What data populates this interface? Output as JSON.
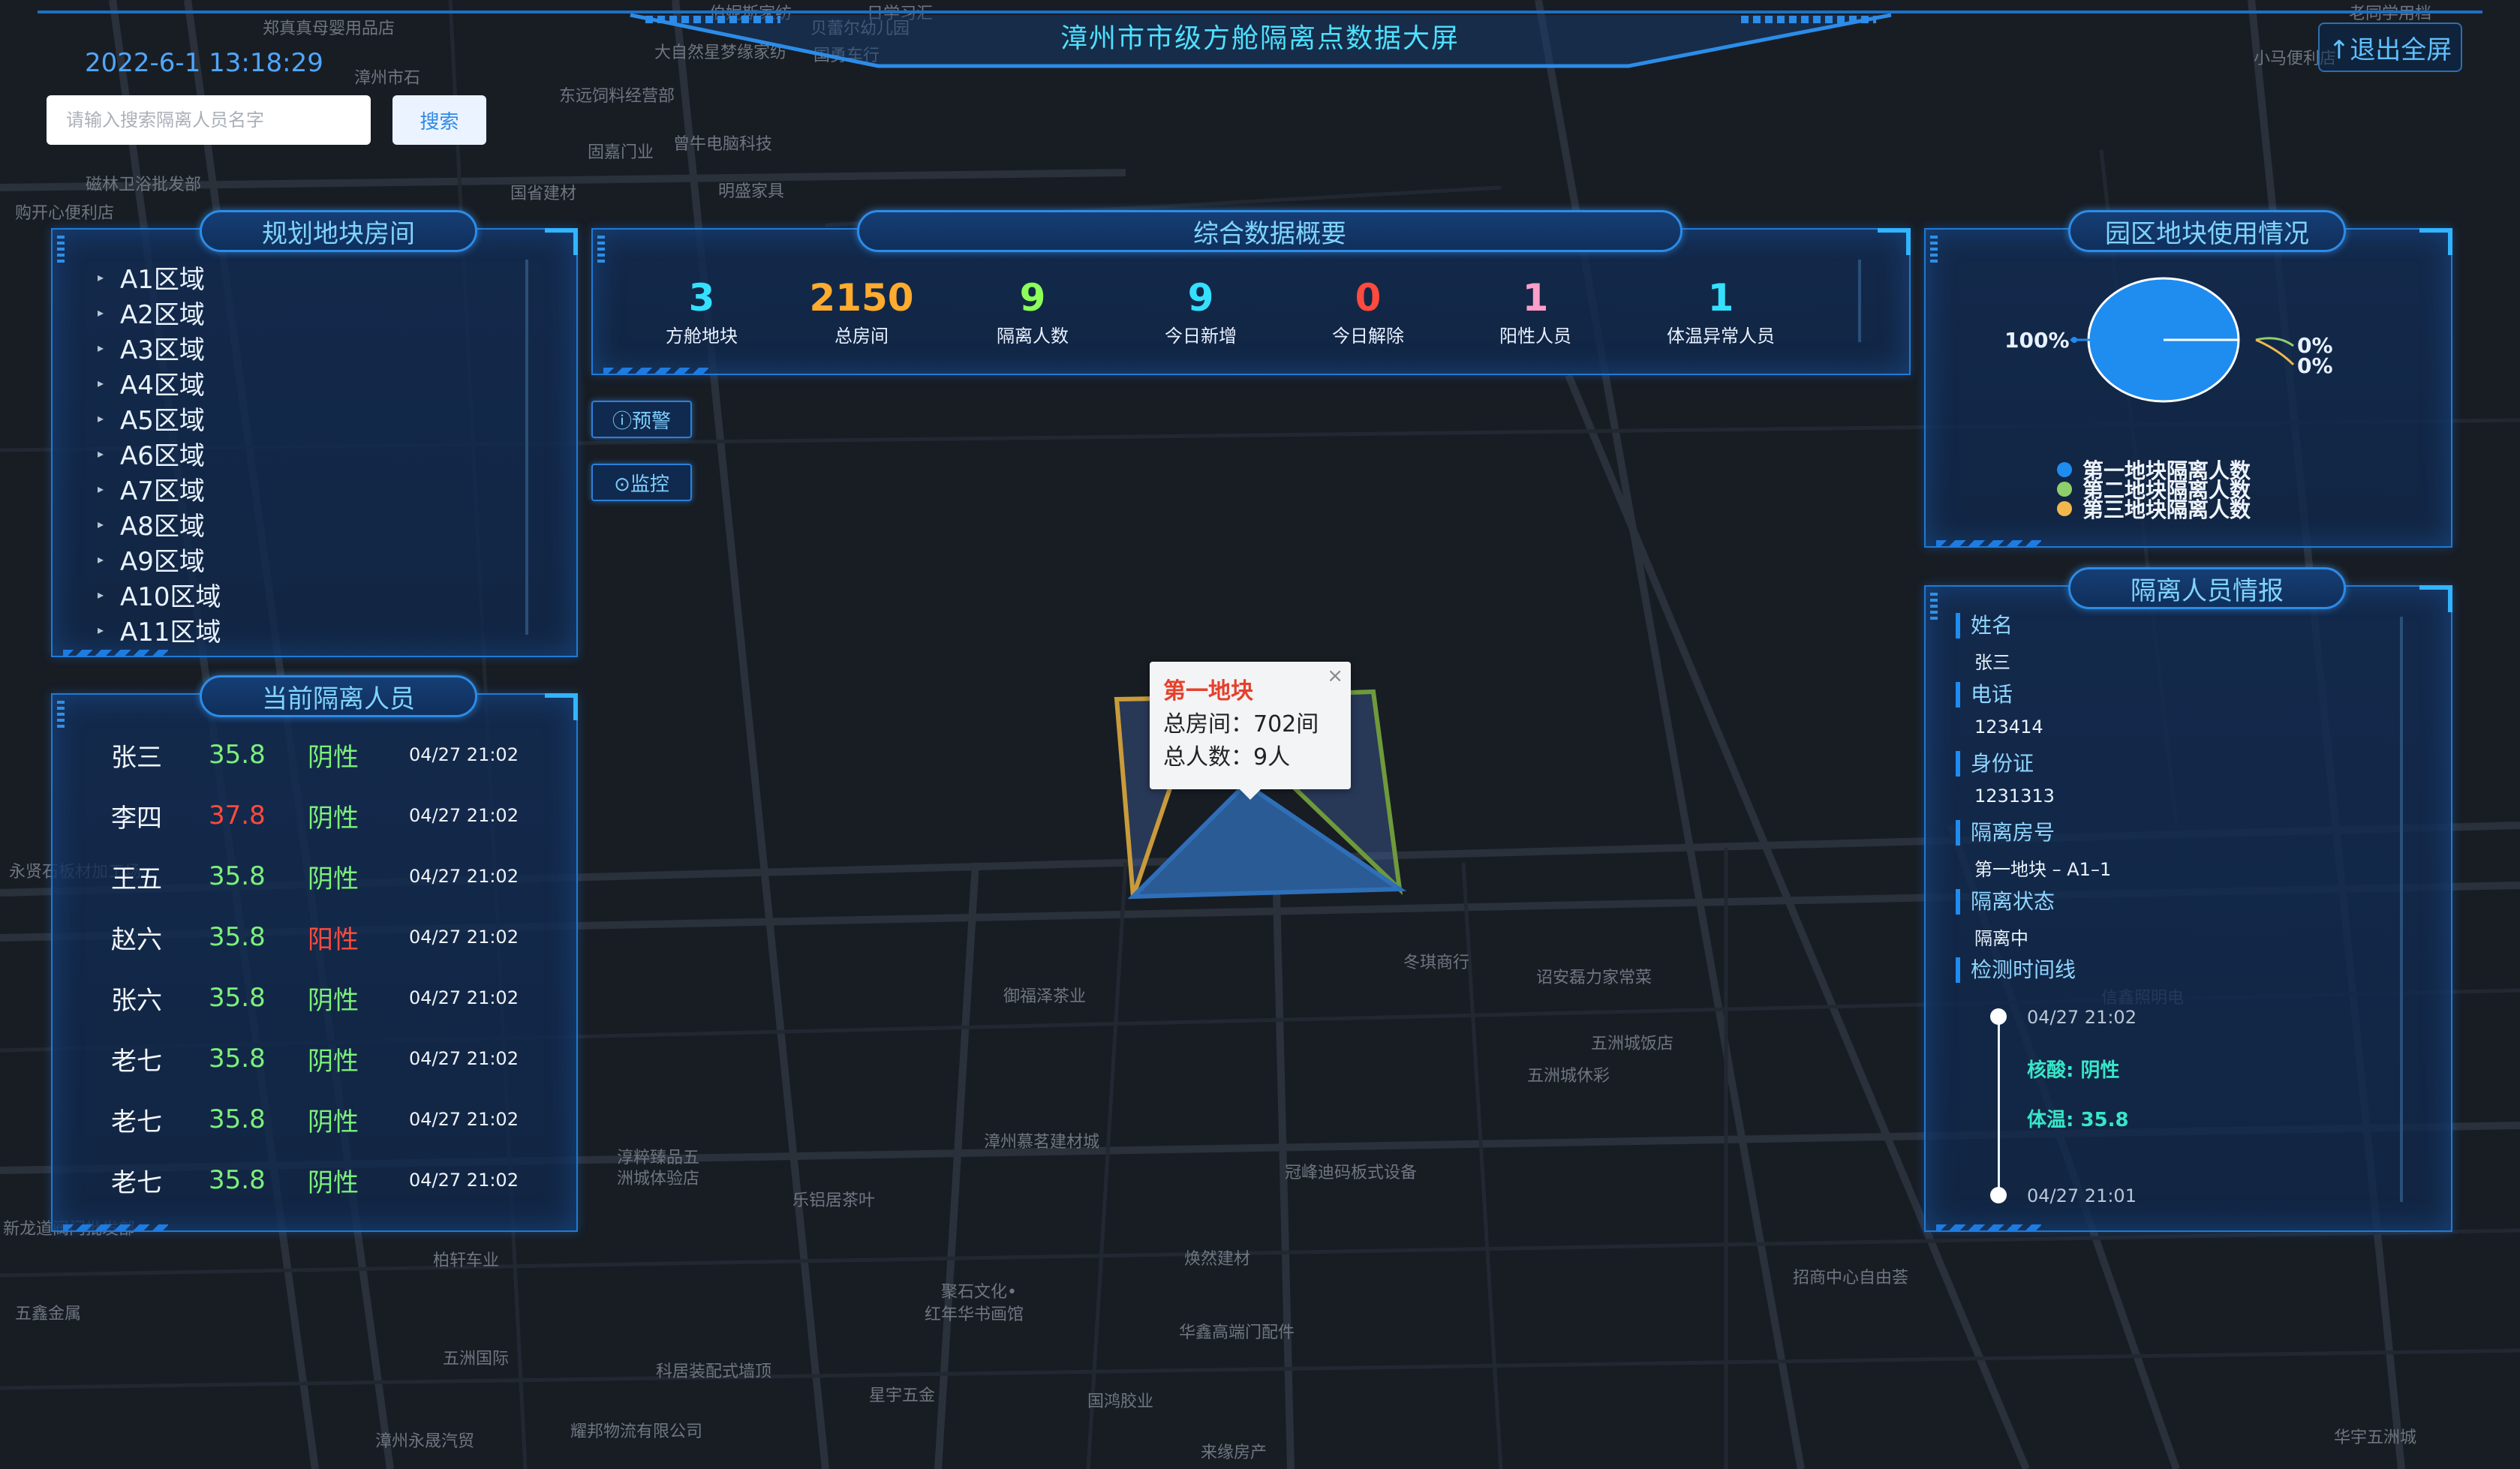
{
  "header": {
    "title": "漳州市市级方舱隔离点数据大屏",
    "datetime": "2022-6-1 13:18:29",
    "exit_label": "↑退出全屏"
  },
  "search": {
    "placeholder": "请输入搜索隔离人员名字",
    "button": "搜索"
  },
  "regions_panel": {
    "title": "规划地块房间",
    "items": [
      "A1区域",
      "A2区域",
      "A3区域",
      "A4区域",
      "A5区域",
      "A6区域",
      "A7区域",
      "A8区域",
      "A9区域",
      "A10区域",
      "A11区域"
    ]
  },
  "people_panel": {
    "title": "当前隔离人员",
    "rows": [
      {
        "name": "张三",
        "temp": "35.8",
        "result": "阴性",
        "time": "04/27 21:02",
        "temp_color": "#7cf07a",
        "result_color": "#7cf07a"
      },
      {
        "name": "李四",
        "temp": "37.8",
        "result": "阴性",
        "time": "04/27 21:02",
        "temp_color": "#ff4a3d",
        "result_color": "#7cf07a"
      },
      {
        "name": "王五",
        "temp": "35.8",
        "result": "阴性",
        "time": "04/27 21:02",
        "temp_color": "#7cf07a",
        "result_color": "#7cf07a"
      },
      {
        "name": "赵六",
        "temp": "35.8",
        "result": "阳性",
        "time": "04/27 21:02",
        "temp_color": "#7cf07a",
        "result_color": "#ff4a3d"
      },
      {
        "name": "张六",
        "temp": "35.8",
        "result": "阴性",
        "time": "04/27 21:02",
        "temp_color": "#7cf07a",
        "result_color": "#7cf07a"
      },
      {
        "name": "老七",
        "temp": "35.8",
        "result": "阴性",
        "time": "04/27 21:02",
        "temp_color": "#7cf07a",
        "result_color": "#7cf07a"
      },
      {
        "name": "老七",
        "temp": "35.8",
        "result": "阴性",
        "time": "04/27 21:02",
        "temp_color": "#7cf07a",
        "result_color": "#7cf07a"
      },
      {
        "name": "老七",
        "temp": "35.8",
        "result": "阴性",
        "time": "04/27 21:02",
        "temp_color": "#7cf07a",
        "result_color": "#7cf07a"
      }
    ]
  },
  "summary_panel": {
    "title": "综合数据概要",
    "stats": [
      {
        "value": "3",
        "label": "方舱地块",
        "color": "#35e0ff"
      },
      {
        "value": "2150",
        "label": "总房间",
        "color": "#ffab2e"
      },
      {
        "value": "9",
        "label": "隔离人数",
        "color": "#8cff5a"
      },
      {
        "value": "9",
        "label": "今日新增",
        "color": "#35e0ff"
      },
      {
        "value": "0",
        "label": "今日解除",
        "color": "#ff4a3d"
      },
      {
        "value": "1",
        "label": "阳性人员",
        "color": "#ff9ec8"
      },
      {
        "value": "1",
        "label": "体温异常人员",
        "color": "#35e0ff"
      }
    ]
  },
  "side_buttons": {
    "warning": "ⓘ预警",
    "monitor": "⊙监控"
  },
  "usage_panel": {
    "title": "园区地块使用情况",
    "labels": {
      "main": "100%",
      "second": "0%",
      "third": "0%"
    },
    "legend": [
      {
        "label": "第一地块隔离人数",
        "color": "#1f8cf0"
      },
      {
        "label": "第二地块隔离人数",
        "color": "#8fcf6b"
      },
      {
        "label": "第三地块隔离人数",
        "color": "#f2b84b"
      }
    ]
  },
  "chart_data": {
    "type": "pie",
    "categories": [
      "第一地块隔离人数",
      "第二地块隔离人数",
      "第三地块隔离人数"
    ],
    "values": [
      100,
      0,
      0
    ],
    "title": "园区地块使用情况",
    "legend": "bottom"
  },
  "info_panel": {
    "title": "隔离人员情报",
    "fields": [
      {
        "label": "姓名",
        "value": "张三"
      },
      {
        "label": "电话",
        "value": "123414"
      },
      {
        "label": "身份证",
        "value": "1231313"
      },
      {
        "label": "隔离房号",
        "value": "第一地块 – A1–1"
      },
      {
        "label": "隔离状态",
        "value": "隔离中"
      }
    ],
    "timeline_label": "检测时间线",
    "timeline": {
      "start_time": "04/27 21:02",
      "nucleic": "核酸:  阴性",
      "temp": "体温:  35.8",
      "end_time": "04/27 21:01"
    }
  },
  "popup": {
    "title": "第一地块",
    "rooms": "总房间：702间",
    "people": "总人数：9人",
    "close": "×"
  },
  "map_labels": [
    "郑真真母婴用品店",
    "伯妮斯家纺",
    "日学习汇",
    "贝蕾尔幼儿园",
    "大自然星梦缘家纺",
    "国勇车行",
    "漳州市石",
    "东远饲料经营部",
    "固嘉门业",
    "曾牛电脑科技",
    "国省建材",
    "明盛家具",
    "磁林卫浴批发部",
    "购开心便利店",
    "小马便利店",
    "老同学用档",
    "永贤石板材加工场",
    "冬琪商行",
    "诏安磊力家常菜",
    "五洲城饭店",
    "五洲城休彩",
    "御福泽茶业",
    "漳州慕茗建材城",
    "冠峰迪码板式设备",
    "淳粹臻品五",
    "洲城体验店",
    "乐铝居茶叶",
    "柏轩车业",
    "焕然建材",
    "聚石文化•",
    "红年华书画馆",
    "华鑫高端门配件",
    "招商中心自由荟",
    "五鑫金属",
    "五洲国际",
    "科居装配式墙顶",
    "星宇五金",
    "国鸿胶业",
    "耀邦物流有限公司",
    "漳州永晟汽贸",
    "来缘房产",
    "华宇五洲城",
    "新龙道阀门批发部",
    "信鑫照明电"
  ]
}
